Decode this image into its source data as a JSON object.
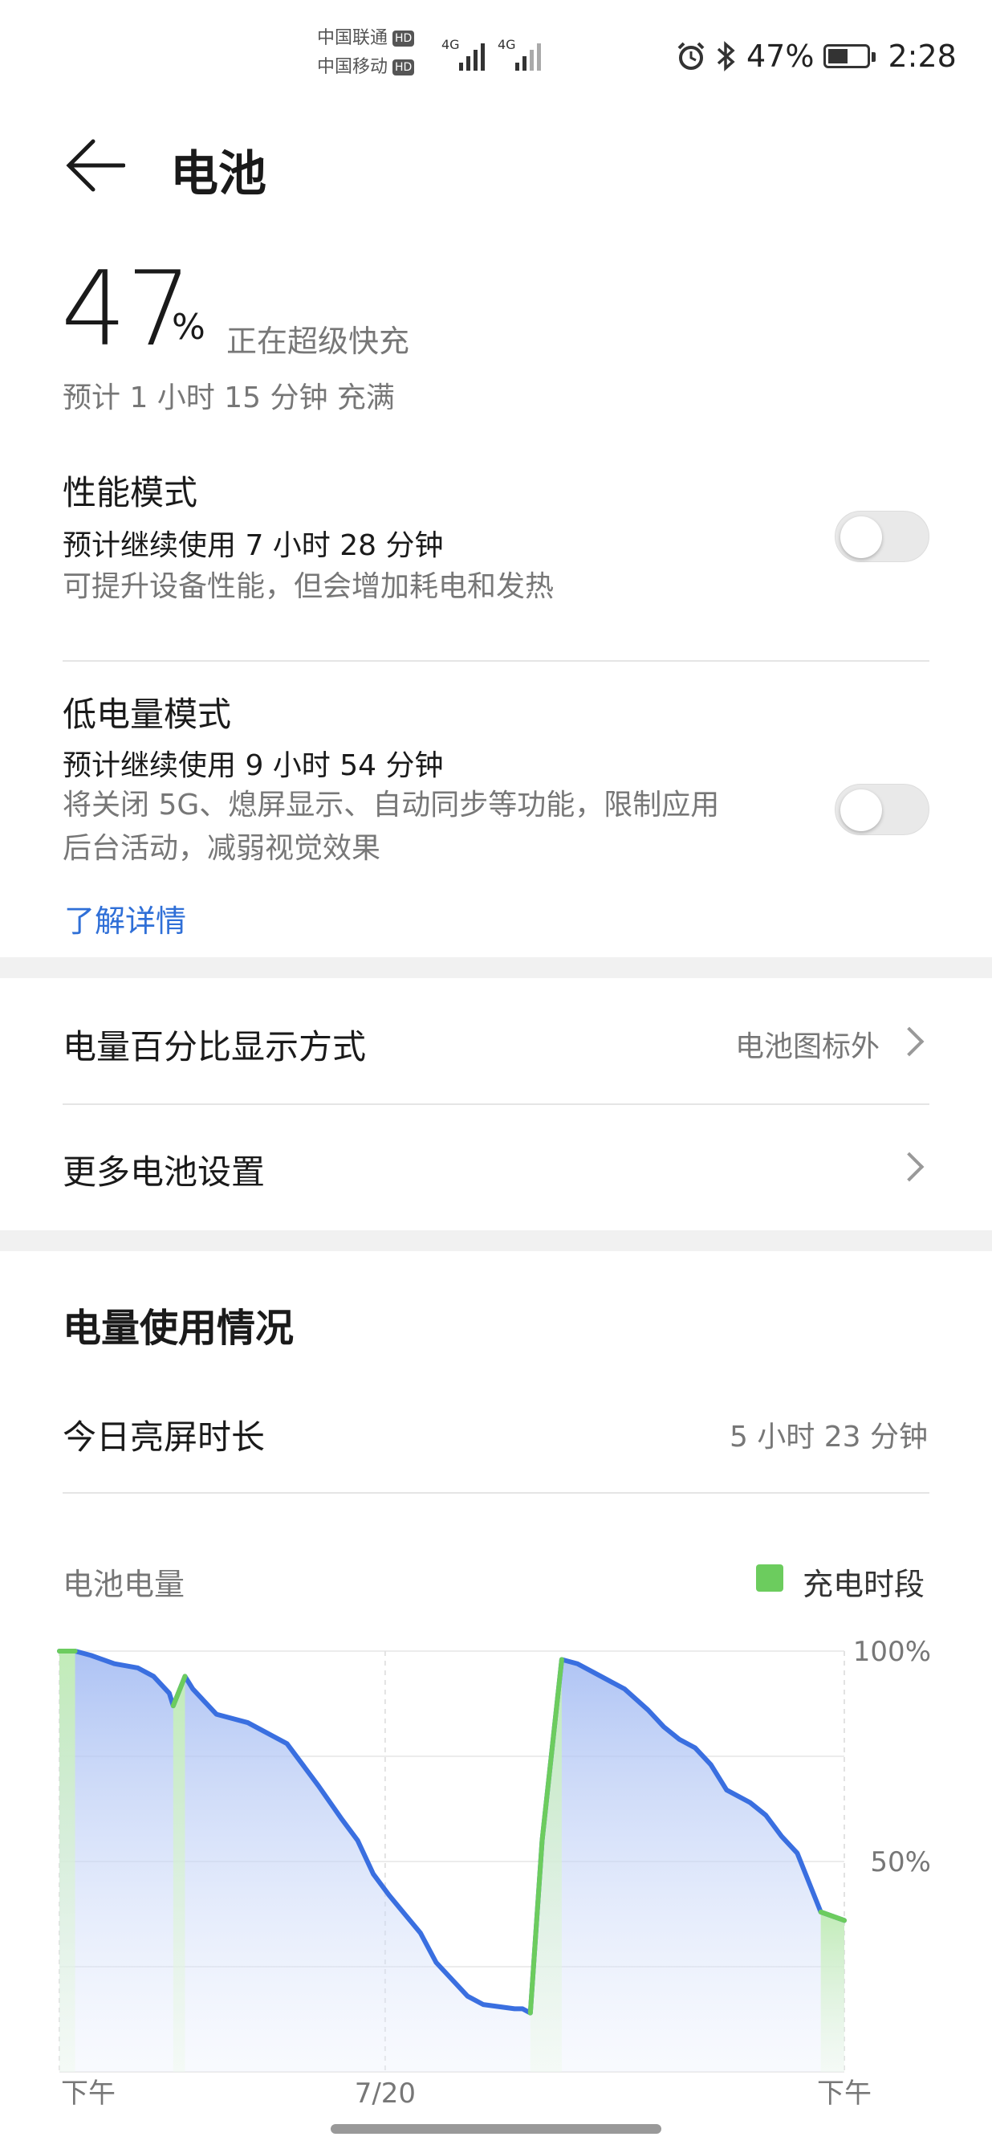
{
  "status_bar": {
    "carrier1": "中国联通",
    "carrier2": "中国移动",
    "hd": "HD",
    "net1": "4G",
    "net2": "4G",
    "battery_pct": "47%",
    "time": "2:28",
    "icons": [
      "alarm-icon",
      "bluetooth-icon",
      "battery-charging-icon"
    ]
  },
  "header": {
    "title": "电池"
  },
  "battery": {
    "percent": "47",
    "unit": "%",
    "status": "正在超级快充",
    "estimate": "预计 1 小时 15 分钟 充满"
  },
  "performance_mode": {
    "title": "性能模式",
    "estimate": "预计继续使用 7 小时 28 分钟",
    "description": "可提升设备性能，但会增加耗电和发热",
    "enabled": false
  },
  "low_power_mode": {
    "title": "低电量模式",
    "estimate": "预计继续使用 9 小时 54 分钟",
    "description_line1": "将关闭 5G、熄屏显示、自动同步等功能，限制应用",
    "description_line2": "后台活动，减弱视觉效果",
    "link": "了解详情",
    "enabled": false
  },
  "settings": {
    "percentage_display_label": "电量百分比显示方式",
    "percentage_display_value": "电池图标外",
    "more_settings_label": "更多电池设置"
  },
  "usage": {
    "section_title": "电量使用情况",
    "screen_time_label": "今日亮屏时长",
    "screen_time_value": "5 小时 23 分钟"
  },
  "chart_data": {
    "type": "area",
    "title": "电池电量",
    "legend": [
      {
        "name": "充电时段",
        "color": "#6ccc5e"
      }
    ],
    "ylim": [
      0,
      100
    ],
    "y_ticks": [
      "100%",
      "50%"
    ],
    "x_ticks": [
      "下午",
      "7/20",
      "下午"
    ],
    "grid": true,
    "line_color": "#3a6fe0",
    "charge_color": "#6ccc5e",
    "series": [
      {
        "values": [
          [
            0,
            100
          ],
          [
            2,
            100
          ],
          [
            4,
            99
          ],
          [
            7,
            97
          ],
          [
            10,
            96
          ],
          [
            12,
            94
          ],
          [
            14,
            90
          ],
          [
            14.5,
            87
          ],
          [
            16,
            94
          ],
          [
            17,
            91
          ],
          [
            20,
            85
          ],
          [
            24,
            83
          ],
          [
            26,
            81
          ],
          [
            29,
            78
          ],
          [
            33,
            68
          ],
          [
            36,
            60
          ],
          [
            38,
            55
          ],
          [
            40,
            47
          ],
          [
            42,
            42
          ],
          [
            46,
            33
          ],
          [
            48,
            26
          ],
          [
            52,
            18
          ],
          [
            54,
            16
          ],
          [
            58,
            15
          ],
          [
            59,
            15
          ],
          [
            60,
            14
          ],
          [
            61.5,
            55
          ],
          [
            64,
            98
          ],
          [
            66,
            97
          ],
          [
            69,
            94
          ],
          [
            72,
            91
          ],
          [
            75,
            86
          ],
          [
            77,
            82
          ],
          [
            79,
            79
          ],
          [
            81,
            77
          ],
          [
            83,
            73
          ],
          [
            85,
            67
          ],
          [
            88,
            64
          ],
          [
            90,
            61
          ],
          [
            92,
            56
          ],
          [
            94,
            52
          ],
          [
            97,
            38
          ],
          [
            100,
            36
          ]
        ]
      }
    ],
    "charging_periods": [
      [
        0,
        2
      ],
      [
        14.5,
        16
      ],
      [
        60,
        64
      ],
      [
        97,
        100
      ]
    ]
  }
}
